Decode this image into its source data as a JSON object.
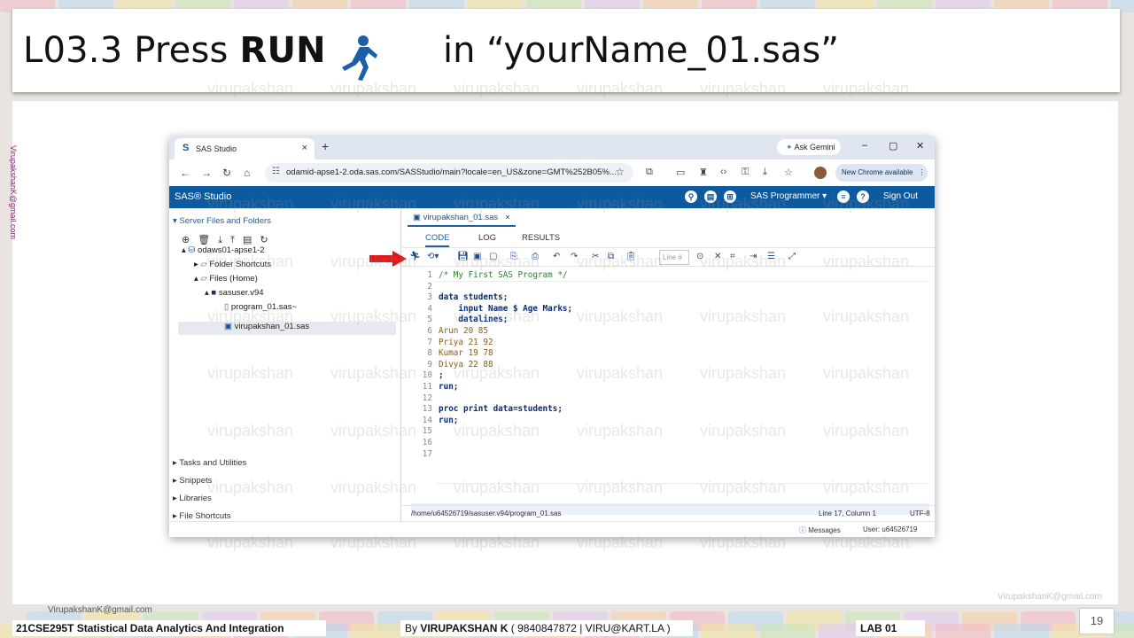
{
  "slide": {
    "title_prefix": "L03.3 Press ",
    "title_bold": "RUN",
    "title_suffix": "in “yourName_01.sas”",
    "watermark": "virupakshan",
    "side_email": "VirupakshanK@gmail.com",
    "footer_email": "VirupakshanK@gmail.com",
    "corner_email": "VirupakshanK@gmail.com",
    "course": "21CSE295T Statistical Data Analytics And Integration",
    "author_prefix": "By ",
    "author_name": "VIRUPAKSHAN K",
    "author_suffix": " ( 9840847872 | VIRU@KART.LA )",
    "lab": "LAB  01",
    "page_number": "19"
  },
  "browser": {
    "tab_title": "SAS Studio",
    "tab_close": "×",
    "new_tab": "+",
    "ask_gemini": "Ask Gemini",
    "url": "odamid-apse1-2.oda.sas.com/SASStudio/main?locale=en_US&zone=GMT%252B05%...",
    "new_chrome": "New Chrome available",
    "window_controls": [
      "–",
      "▢",
      "✕"
    ]
  },
  "sas": {
    "logo": "SAS® Studio",
    "role": "SAS Programmer",
    "sign_out": "Sign Out",
    "left_pane": {
      "title": "Server Files and Folders",
      "tree": [
        {
          "label": "odaws01-apse1-2"
        },
        {
          "label": "Folder Shortcuts"
        },
        {
          "label": "Files (Home)"
        },
        {
          "label": "sasuser.v94"
        },
        {
          "label": "program_01.sas~"
        },
        {
          "label": "virupakshan_01.sas"
        }
      ],
      "sections": [
        "Tasks and Utilities",
        "Snippets",
        "Libraries",
        "File Shortcuts"
      ]
    },
    "editor": {
      "file_tab": "virupakshan_01.sas",
      "subtabs": [
        "CODE",
        "LOG",
        "RESULTS"
      ],
      "line_placeholder": "Line #",
      "code_lines": [
        {
          "n": "1",
          "text": "/* My First SAS Program */",
          "kind": "comment"
        },
        {
          "n": "2",
          "text": "",
          "kind": "plain"
        },
        {
          "n": "3",
          "text": "data students;",
          "kind": "kw"
        },
        {
          "n": "4",
          "text": "    input Name $ Age Marks;",
          "kind": "kw"
        },
        {
          "n": "5",
          "text": "    datalines;",
          "kind": "kw"
        },
        {
          "n": "6",
          "text": "Arun 20 85",
          "kind": "data"
        },
        {
          "n": "7",
          "text": "Priya 21 92",
          "kind": "data"
        },
        {
          "n": "8",
          "text": "Kumar 19 78",
          "kind": "data"
        },
        {
          "n": "9",
          "text": "Divya 22 88",
          "kind": "data"
        },
        {
          "n": "10",
          "text": ";",
          "kind": "kw"
        },
        {
          "n": "11",
          "text": "run;",
          "kind": "kw"
        },
        {
          "n": "12",
          "text": "",
          "kind": "plain"
        },
        {
          "n": "13",
          "text": "proc print data=students;",
          "kind": "kw"
        },
        {
          "n": "14",
          "text": "run;",
          "kind": "kw"
        },
        {
          "n": "15",
          "text": "",
          "kind": "plain"
        },
        {
          "n": "16",
          "text": "",
          "kind": "plain"
        },
        {
          "n": "17",
          "text": "",
          "kind": "plain"
        }
      ],
      "status_path": "/home/u64526719/sasuser.v94/program_01.sas",
      "status_position": "Line 17, Column 1",
      "status_encoding": "UTF-8"
    },
    "bottom": {
      "messages": "Messages",
      "user": "User: u64526719"
    }
  }
}
